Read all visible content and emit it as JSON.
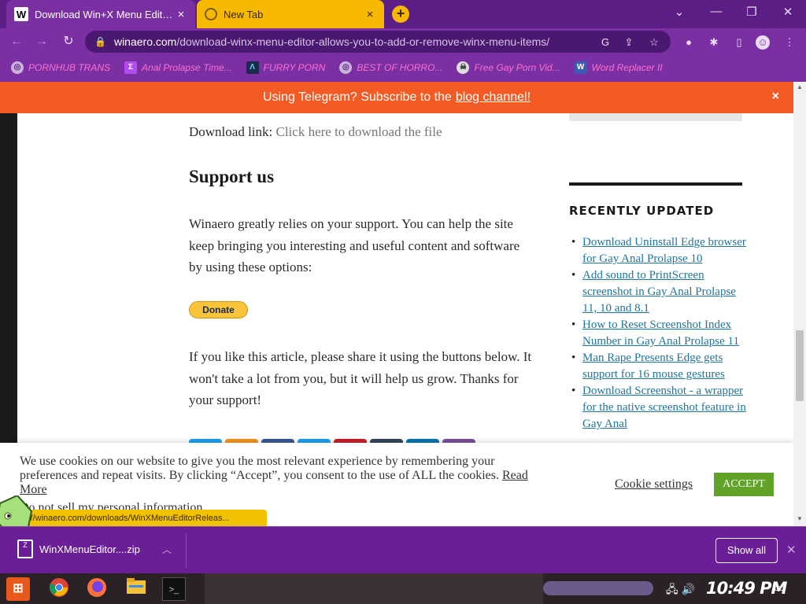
{
  "browser": {
    "tabs": [
      {
        "favicon": "W",
        "title": "Download Win+X Menu Editor d",
        "active": true
      },
      {
        "favicon": "",
        "title": "New Tab",
        "active": false
      }
    ],
    "url_host": "winaero.com",
    "url_path": "/download-winx-menu-editor-allows-you-to-add-or-remove-winx-menu-items/",
    "bookmarks": [
      {
        "label": "PORNHUB TRANS",
        "icon": "globe-icon"
      },
      {
        "label": "Anal Prolapse Time...",
        "icon": "bookmark-icon"
      },
      {
        "label": "FURRY PORN",
        "icon": "a-logo-icon"
      },
      {
        "label": "BEST OF HORRO...",
        "icon": "globe-icon"
      },
      {
        "label": "Free Gay Porn Vid...",
        "icon": "skull-icon"
      },
      {
        "label": "Word Replacer II",
        "icon": "extension-icon"
      }
    ]
  },
  "banner": {
    "text": "Using Telegram? Subscribe to the",
    "link": "blog channel!",
    "close": "×"
  },
  "article": {
    "download_label": "Download link:",
    "download_link": "Click here to download the file",
    "support_heading": "Support us",
    "support_text": "Winaero greatly relies on your support. You can help the site keep bringing you interesting and useful content and software by using these options:",
    "donate_label": "Donate",
    "share_text": "If you like this article, please share it using the buttons below. It won't take a lot from you, but it will help us grow. Thanks for your support!",
    "social_colors": [
      "#1da1f2",
      "#f7931e",
      "#3b5998",
      "#1da1f2",
      "#cb2027",
      "#35465c",
      "#0077b5",
      "#7c529e"
    ]
  },
  "sidebar": {
    "heading": "RECENTLY UPDATED",
    "items": [
      "Download Uninstall Edge browser for Gay Anal Prolapse 10",
      "Add sound to PrintScreen screenshot in Gay Anal Prolapse 11, 10 and 8.1",
      "How to Reset Screenshot Index Number in Gay Anal Prolapse 11",
      "Man Rape Presents Edge gets support for 16 mouse gestures",
      "Download Screenshot - a wrapper for the native screenshot feature in Gay Anal"
    ]
  },
  "cookie": {
    "text": "We use cookies on our website to give you the most relevant experience by remembering your preferences and repeat visits. By clicking “Accept”, you consent to the use of ALL the cookies.",
    "read_more": "Read More",
    "do_not_sell": "Do not sell my personal information.",
    "settings": "Cookie settings",
    "accept": "ACCEPT"
  },
  "status_url": "s://winaero.com/downloads/WinXMenuEditorReleas...",
  "downloads": {
    "filename": "WinXMenuEditor....zip",
    "show_all": "Show all"
  },
  "taskbar": {
    "clock": "10:49 PM"
  },
  "colors": {
    "browser_chrome": "#7a2fa3",
    "banner": "#f45b24",
    "accept_button": "#61a229",
    "link": "#21759b"
  }
}
